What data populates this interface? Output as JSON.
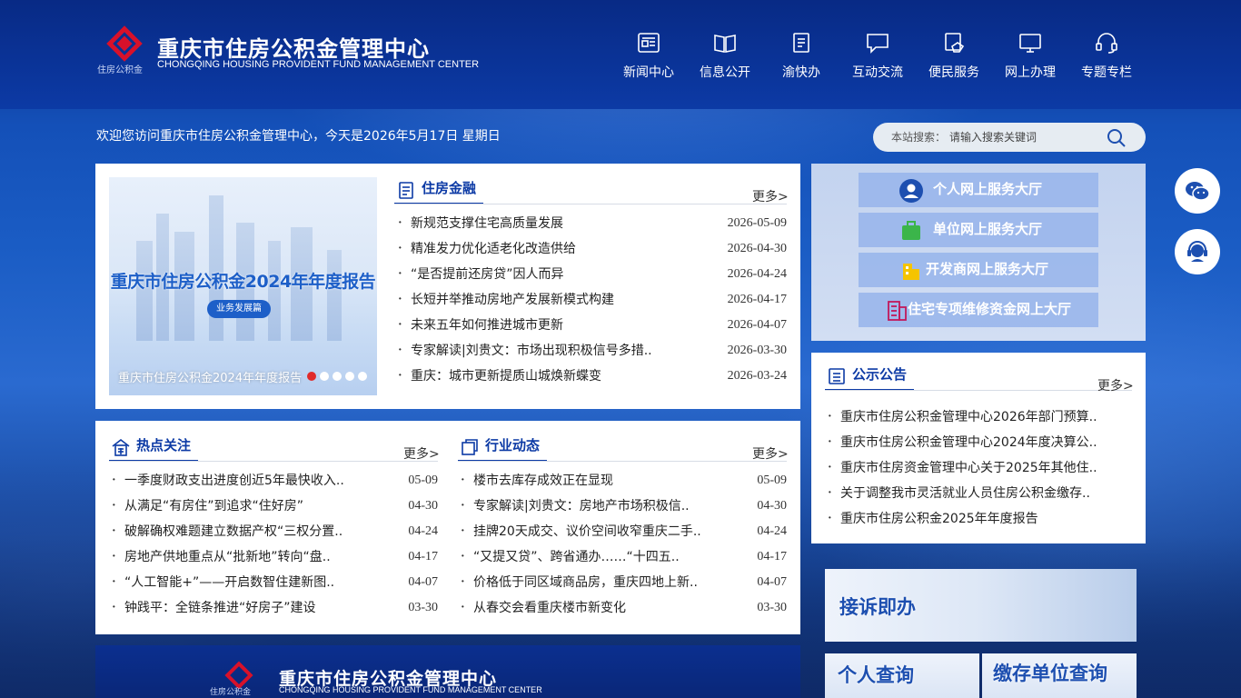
{
  "colors": {
    "brand_blue": "#0c3aa5",
    "accent_red": "#d8112a",
    "panel_bg": "#ffffff"
  },
  "header": {
    "logo_title": "重庆市住房公积金管理中心",
    "logo_subtitle": "CHONGQING HOUSING PROVIDENT FUND MANAGEMENT CENTER",
    "logo_tiny": "住房公积金"
  },
  "nav": [
    {
      "label": "新闻中心",
      "icon": "newspaper-icon"
    },
    {
      "label": "信息公开",
      "icon": "book-icon"
    },
    {
      "label": "渝快办",
      "icon": "clipboard-icon"
    },
    {
      "label": "互动交流",
      "icon": "chat-bubble-icon"
    },
    {
      "label": "便民服务",
      "icon": "service-hand-icon"
    },
    {
      "label": "网上办理",
      "icon": "monitor-icon"
    },
    {
      "label": "专题专栏",
      "icon": "headset-icon"
    }
  ],
  "welcome": "欢迎您访问重庆市住房公积金管理中心，今天是2026年5月17日 星期日",
  "search": {
    "label": "本站搜索：",
    "placeholder": "请输入搜索关键词"
  },
  "banner": {
    "title": "重庆市住房公积金2024年年度报告",
    "tag": "业务发展篇",
    "caption": "重庆市住房公积金2024年年度报告"
  },
  "housing_finance": {
    "title": "住房金融",
    "more": "更多>",
    "items": [
      {
        "title": "新规范支撑住宅高质量发展",
        "date": "2026-05-09"
      },
      {
        "title": "精准发力优化适老化改造供给",
        "date": "2026-04-30"
      },
      {
        "title": "“是否提前还房贷”因人而异",
        "date": "2026-04-24"
      },
      {
        "title": "长短并举推动房地产发展新模式构建",
        "date": "2026-04-17"
      },
      {
        "title": "未来五年如何推进城市更新",
        "date": "2026-04-07"
      },
      {
        "title": "专家解读|刘贵文：市场出现积极信号多措..",
        "date": "2026-03-30"
      },
      {
        "title": "重庆：城市更新提质山城焕新蝶变",
        "date": "2026-03-24"
      }
    ]
  },
  "hot_focus": {
    "title": "热点关注",
    "more": "更多>",
    "items": [
      {
        "title": "一季度财政支出进度创近5年最快收入..",
        "date": "05-09"
      },
      {
        "title": "从满足“有房住”到追求“住好房”",
        "date": "04-30"
      },
      {
        "title": "破解确权难题建立数据产权“三权分置..",
        "date": "04-24"
      },
      {
        "title": "房地产供地重点从“批新地”转向“盘..",
        "date": "04-17"
      },
      {
        "title": "“人工智能+”——开启数智住建新图..",
        "date": "04-07"
      },
      {
        "title": "钟践平：全链条推进“好房子”建设",
        "date": "03-30"
      }
    ]
  },
  "industry_news": {
    "title": "行业动态",
    "more": "更多>",
    "items": [
      {
        "title": "楼市去库存成效正在显现",
        "date": "05-09"
      },
      {
        "title": "专家解读|刘贵文：房地产市场积极信..",
        "date": "04-30"
      },
      {
        "title": "挂牌20天成交、议价空间收窄重庆二手..",
        "date": "04-24"
      },
      {
        "title": "“又提又贷”、跨省通办……“十四五..",
        "date": "04-17"
      },
      {
        "title": "价格低于同区域商品房，重庆四地上新..",
        "date": "04-07"
      },
      {
        "title": "从春交会看重庆楼市新变化",
        "date": "03-30"
      }
    ]
  },
  "services": [
    {
      "label": "个人网上服务大厅",
      "icon": "person-icon"
    },
    {
      "label": "单位网上服务大厅",
      "icon": "briefcase-icon"
    },
    {
      "label": "开发商网上服务大厅",
      "icon": "building-icon"
    },
    {
      "label": "住宅专项维修资金网上大厅",
      "icon": "apartment-icon"
    }
  ],
  "notices": {
    "title": "公示公告",
    "more": "更多>",
    "items": [
      {
        "title": "重庆市住房公积金管理中心2026年部门预算.."
      },
      {
        "title": "重庆市住房公积金管理中心2024年度决算公.."
      },
      {
        "title": "重庆市住房资金管理中心关于2025年其他住.."
      },
      {
        "title": "关于调整我市灵活就业人员住房公积金缴存.."
      },
      {
        "title": "重庆市住房公积金2025年年度报告"
      }
    ]
  },
  "quick_links": {
    "complaint": "接诉即办",
    "personal_query": "个人查询",
    "unit_query": "缴存单位查询"
  },
  "footer": {
    "title": "重庆市住房公积金管理中心",
    "subtitle": "CHONGQING HOUSING PROVIDENT FUND MANAGEMENT CENTER",
    "tiny": "住房公积金"
  }
}
